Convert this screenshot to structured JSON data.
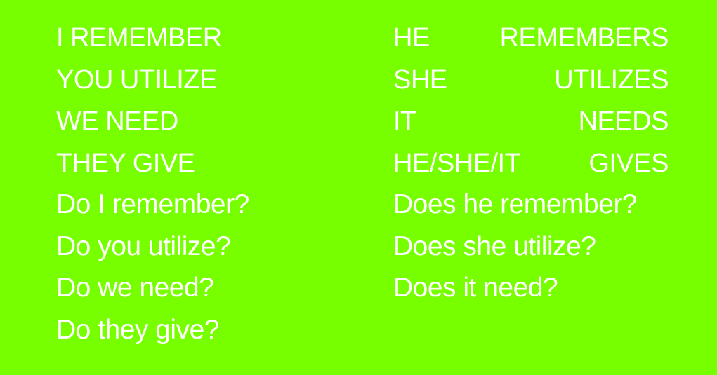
{
  "colors": {
    "background": "#77FF00",
    "text": "#FFFFFF"
  },
  "left_column": {
    "statements": [
      "I REMEMBER",
      "YOU UTILIZE",
      "WE NEED",
      "THEY GIVE"
    ],
    "questions": [
      "Do I remember?",
      "Do you utilize?",
      "Do we need?",
      "Do they give?"
    ]
  },
  "right_column": {
    "statements": [
      {
        "subject": "HE",
        "verb": "REMEMBERS"
      },
      {
        "subject": "SHE",
        "verb": "UTILIZES"
      },
      {
        "subject": "IT",
        "verb": "NEEDS"
      },
      {
        "subject": "HE/SHE/IT",
        "verb": "GIVES"
      }
    ],
    "questions": [
      "Does he remember?",
      "Does she utilize?",
      "Does it need?"
    ]
  }
}
